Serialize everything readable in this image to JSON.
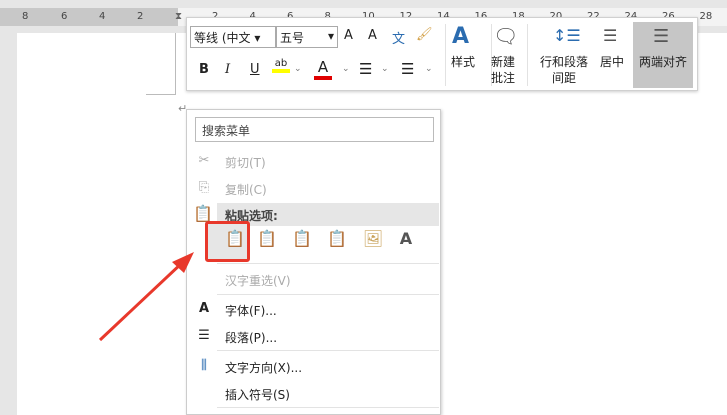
{
  "ruler": {
    "left": [
      "8",
      "6",
      "4",
      "2"
    ],
    "right": [
      "2",
      "4",
      "6",
      "8",
      "10",
      "12",
      "14",
      "16",
      "18",
      "20",
      "22",
      "24",
      "26",
      "28"
    ]
  },
  "toolbar": {
    "font": "等线 (中文",
    "size": "五号",
    "grow": "A",
    "shrink": "A",
    "pinyin": "文",
    "format_painter": "🖌",
    "bold": "B",
    "italic": "I",
    "underline": "U",
    "highlight": "ab",
    "font_color": "A",
    "bullets": "☰",
    "numbering": "☰",
    "styles": "样式",
    "new_comment_1": "新建",
    "new_comment_2": "批注",
    "spacing_1": "行和段落",
    "spacing_2": "间距",
    "center": "居中",
    "justify": "两端对齐"
  },
  "menu": {
    "search_placeholder": "搜索菜单",
    "cut": "剪切(T)",
    "copy": "复制(C)",
    "paste_options": "粘贴选项:",
    "reconvert": "汉字重选(V)",
    "font": "字体(F)...",
    "paragraph": "段落(P)...",
    "text_direction": "文字方向(X)...",
    "insert_symbol": "插入符号(S)"
  },
  "colors": {
    "highlight": "#ffff00",
    "font_color": "#e00000",
    "annotation": "#e8382b",
    "accent": "#2b6cb0"
  }
}
